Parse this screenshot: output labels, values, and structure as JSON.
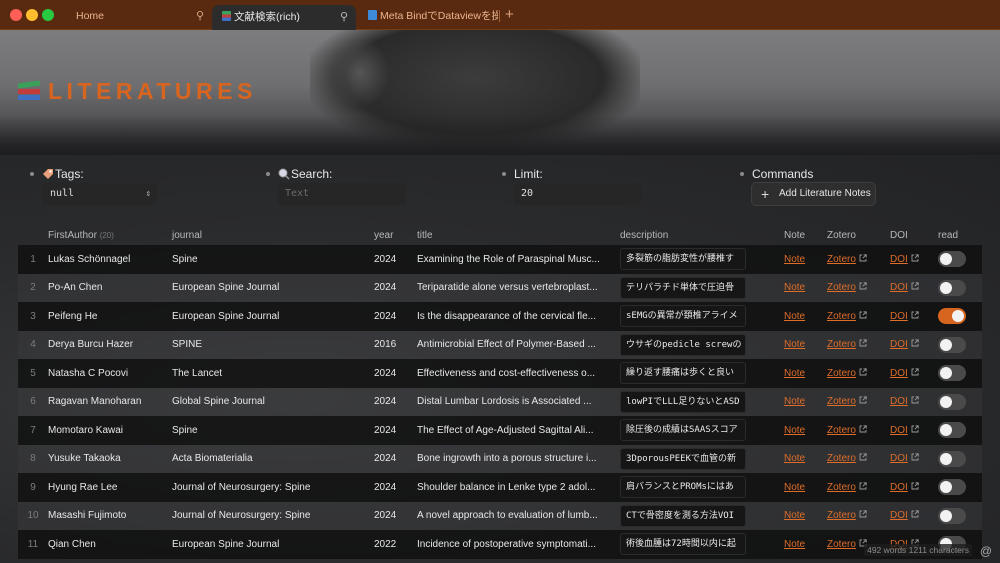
{
  "tabs": [
    {
      "label": "Home"
    },
    {
      "label": "文献検索(rich)"
    },
    {
      "label": "Meta BindでDataviewを操..."
    }
  ],
  "banner": {
    "title": "LITERATURES"
  },
  "controls": {
    "tags": {
      "label": "Tags:",
      "value": "null"
    },
    "search": {
      "label": "Search:",
      "placeholder": "Text"
    },
    "limit": {
      "label": "Limit:",
      "value": "20"
    },
    "commands": {
      "label": "Commands",
      "button": "Add Literature Notes"
    }
  },
  "table": {
    "headers": {
      "author": "FirstAuthor",
      "count": "(20)",
      "journal": "journal",
      "year": "year",
      "title": "title",
      "description": "description",
      "note": "Note",
      "zotero": "Zotero",
      "doi": "DOI",
      "read": "read"
    },
    "link_labels": {
      "note": "Note",
      "zotero": "Zotero",
      "doi": "DOI"
    },
    "rows": [
      {
        "n": "1",
        "author": "Lukas Schönnagel",
        "journal": "Spine",
        "year": "2024",
        "title": "Examining the Role of Paraspinal Musc...",
        "desc": "多裂筋の脂肪変性が腰椎す",
        "read": false
      },
      {
        "n": "2",
        "author": "Po-An Chen",
        "journal": "European Spine Journal",
        "year": "2024",
        "title": "Teriparatide alone versus vertebroplast...",
        "desc": "テリパラチド単体で圧迫骨",
        "read": false
      },
      {
        "n": "3",
        "author": "Peifeng He",
        "journal": "European Spine Journal",
        "year": "2024",
        "title": "Is the disappearance of the cervical fle...",
        "desc": "sEMGの異常が頚椎アライメ",
        "read": true
      },
      {
        "n": "4",
        "author": "Derya Burcu Hazer",
        "journal": "SPINE",
        "year": "2016",
        "title": "Antimicrobial Effect of Polymer-Based ...",
        "desc": "ウサギのpedicle screwの",
        "read": false
      },
      {
        "n": "5",
        "author": "Natasha C Pocovi",
        "journal": "The Lancet",
        "year": "2024",
        "title": "Effectiveness and cost-effectiveness o...",
        "desc": "繰り返す腰痛は歩くと良い",
        "read": false
      },
      {
        "n": "6",
        "author": "Ragavan Manoharan",
        "journal": "Global Spine Journal",
        "year": "2024",
        "title": "Distal Lumbar Lordosis is Associated ...",
        "desc": "lowPIでLLL足りないとASD",
        "read": false
      },
      {
        "n": "7",
        "author": "Momotaro Kawai",
        "journal": "Spine",
        "year": "2024",
        "title": "The Effect of Age-Adjusted Sagittal Ali...",
        "desc": "除圧後の成績はSAASスコア",
        "read": false
      },
      {
        "n": "8",
        "author": "Yusuke Takaoka",
        "journal": "Acta Biomaterialia",
        "year": "2024",
        "title": "Bone ingrowth into a porous structure i...",
        "desc": "3DporousPEEKで血管の新",
        "read": false
      },
      {
        "n": "9",
        "author": "Hyung Rae Lee",
        "journal": "Journal of Neurosurgery: Spine",
        "year": "2024",
        "title": "Shoulder balance in Lenke type 2 adol...",
        "desc": "肩バランスとPROMsにはあ",
        "read": false
      },
      {
        "n": "10",
        "author": "Masashi Fujimoto",
        "journal": "Journal of Neurosurgery: Spine",
        "year": "2024",
        "title": "A novel approach to evaluation of lumb...",
        "desc": "CTで骨密度を測る方法VOI",
        "read": false
      },
      {
        "n": "11",
        "author": "Qian Chen",
        "journal": "European Spine Journal",
        "year": "2022",
        "title": "Incidence of postoperative symptomati...",
        "desc": "術後血腫は72時間以内に起",
        "read": false
      }
    ]
  },
  "status": {
    "text": "492 words 1211 characters"
  },
  "colors": {
    "accent": "#d8651f",
    "link": "#de6d2a",
    "titlebar": "#5a2a10"
  }
}
